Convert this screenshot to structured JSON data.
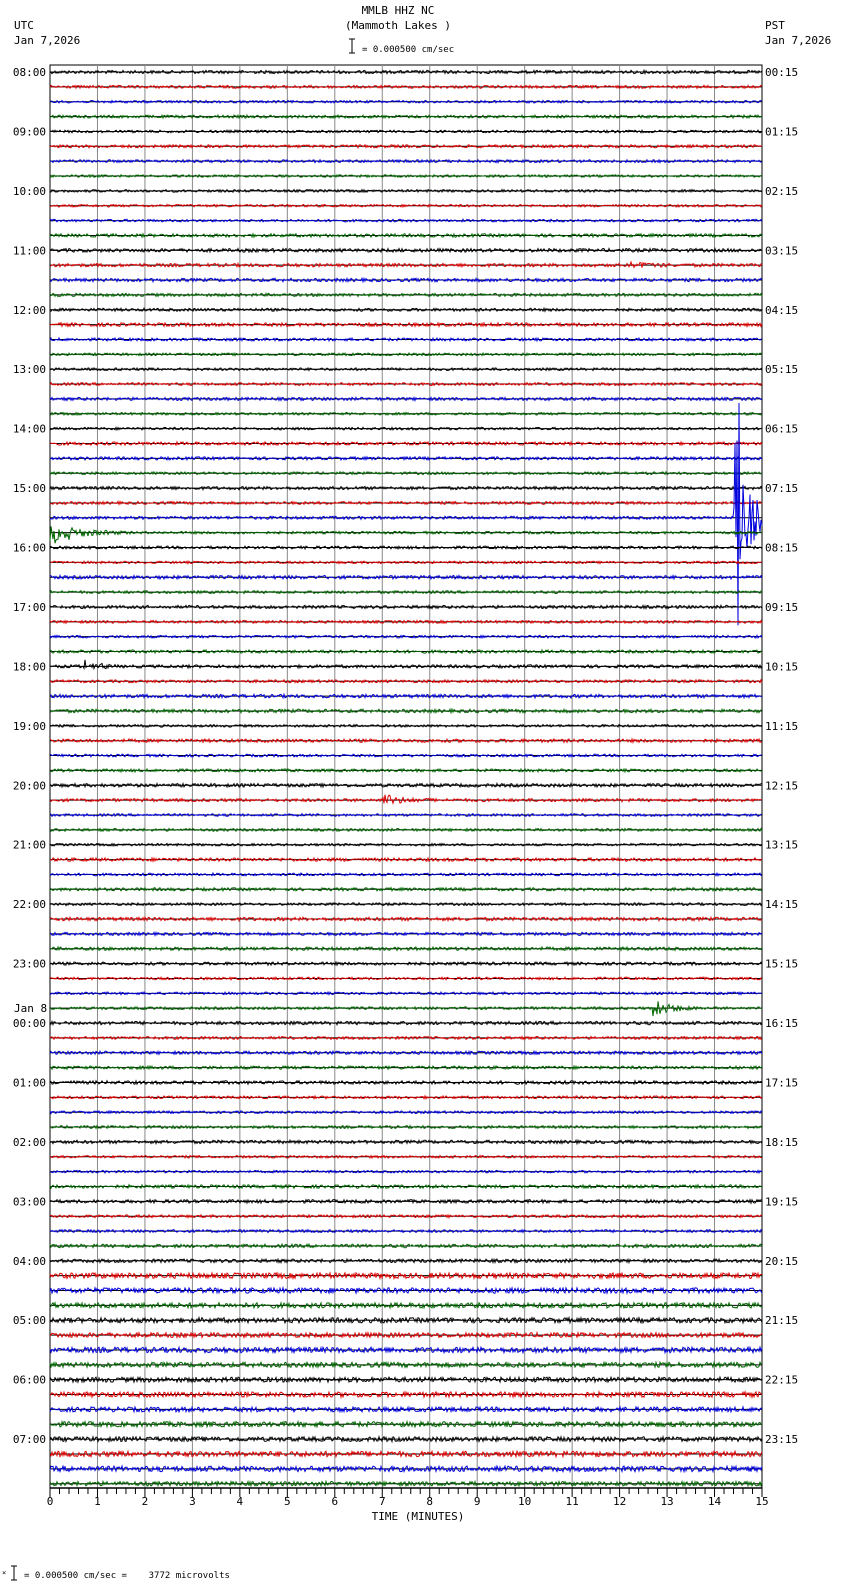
{
  "chart_data": {
    "type": "line",
    "title": "MMLB HHZ NC",
    "subtitle": "(Mammoth Lakes )",
    "left_timezone": "UTC",
    "left_date": "Jan 7,2026",
    "right_timezone": "PST",
    "right_date": "Jan 7,2026",
    "scale_label": "= 0.000500 cm/sec",
    "footer_scale_label": "= 0.000500 cm/sec =    3772 microvolts",
    "xlabel": "TIME (MINUTES)",
    "xlim": [
      0,
      15
    ],
    "x_ticks": [
      "0",
      "1",
      "2",
      "3",
      "4",
      "5",
      "6",
      "7",
      "8",
      "9",
      "10",
      "11",
      "12",
      "13",
      "14",
      "15"
    ],
    "traces_per_hour": 4,
    "trace_colors": [
      "#000000",
      "#dd0000",
      "#0000dd",
      "#006600"
    ],
    "left_hour_labels": [
      "08:00",
      "09:00",
      "10:00",
      "11:00",
      "12:00",
      "13:00",
      "14:00",
      "15:00",
      "16:00",
      "17:00",
      "18:00",
      "19:00",
      "20:00",
      "21:00",
      "22:00",
      "23:00",
      "00:00",
      "01:00",
      "02:00",
      "03:00",
      "04:00",
      "05:00",
      "06:00",
      "07:00"
    ],
    "date_change_label": "Jan 8",
    "date_change_hour_index": 16,
    "right_hour_labels": [
      "00:15",
      "01:15",
      "02:15",
      "03:15",
      "04:15",
      "05:15",
      "06:15",
      "07:15",
      "08:15",
      "09:15",
      "10:15",
      "11:15",
      "12:15",
      "13:15",
      "14:15",
      "15:15",
      "16:15",
      "17:15",
      "18:15",
      "19:15",
      "20:15",
      "21:15",
      "22:15",
      "23:15"
    ],
    "events": [
      {
        "trace": 30,
        "start_min": 14.4,
        "duration_min": 0.6,
        "amplitude_traces": 8
      },
      {
        "trace": 31,
        "start_min": 0.0,
        "duration_min": 1.2,
        "amplitude_traces": 0.6
      },
      {
        "trace": 63,
        "start_min": 12.7,
        "duration_min": 0.6,
        "amplitude_traces": 0.5
      },
      {
        "trace": 40,
        "start_min": 0.7,
        "duration_min": 0.3,
        "amplitude_traces": 0.4
      },
      {
        "trace": 49,
        "start_min": 7.0,
        "duration_min": 0.7,
        "amplitude_traces": 0.3
      },
      {
        "trace": 13,
        "start_min": 12.2,
        "duration_min": 0.5,
        "amplitude_traces": 0.25
      }
    ],
    "grid": true
  }
}
